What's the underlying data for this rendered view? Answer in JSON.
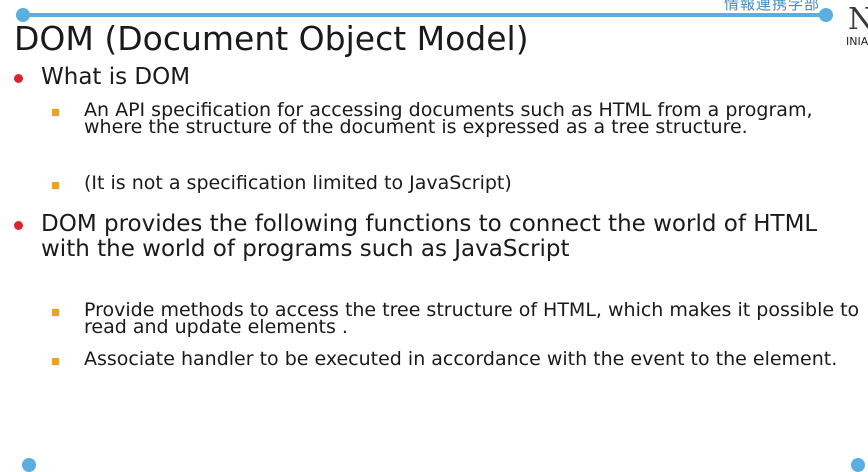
{
  "header": {
    "department": "情報連携学部",
    "logo_letter": "N",
    "logo_text": "INIAD"
  },
  "slide": {
    "title": "DOM (Document Object Model)",
    "bullets": [
      {
        "text": "What is DOM",
        "sub": [
          "An API specification for accessing documents such as HTML from a program, where the structure of the document is expressed as a tree structure.",
          "(It is not a specification limited to JavaScript)"
        ]
      },
      {
        "text": "DOM provides the following functions to connect the world of HTML with the world of programs such as JavaScript",
        "sub": [
          "Provide methods to access the tree structure of HTML, which makes it possible to read and update elements .",
          "Associate handler to be executed in accordance with the event to the element."
        ]
      }
    ]
  },
  "colors": {
    "accent": "#5aaee0",
    "primary_bullet": "#d9262c",
    "secondary_bullet": "#f0a21b"
  }
}
